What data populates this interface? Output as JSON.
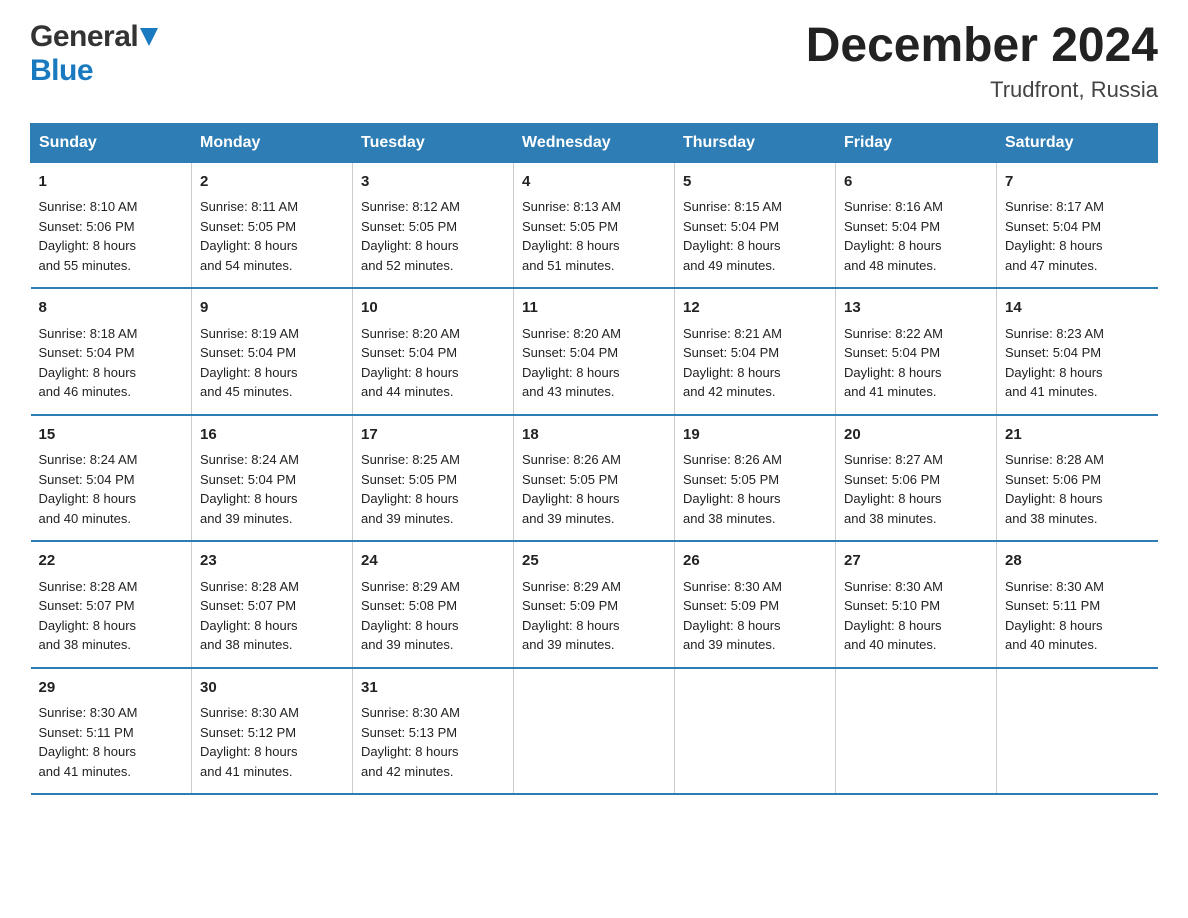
{
  "header": {
    "logo_general": "General",
    "logo_blue": "Blue",
    "title": "December 2024",
    "subtitle": "Trudfront, Russia"
  },
  "columns": [
    "Sunday",
    "Monday",
    "Tuesday",
    "Wednesday",
    "Thursday",
    "Friday",
    "Saturday"
  ],
  "weeks": [
    [
      {
        "day": "1",
        "sunrise": "8:10 AM",
        "sunset": "5:06 PM",
        "daylight": "8 hours and 55 minutes."
      },
      {
        "day": "2",
        "sunrise": "8:11 AM",
        "sunset": "5:05 PM",
        "daylight": "8 hours and 54 minutes."
      },
      {
        "day": "3",
        "sunrise": "8:12 AM",
        "sunset": "5:05 PM",
        "daylight": "8 hours and 52 minutes."
      },
      {
        "day": "4",
        "sunrise": "8:13 AM",
        "sunset": "5:05 PM",
        "daylight": "8 hours and 51 minutes."
      },
      {
        "day": "5",
        "sunrise": "8:15 AM",
        "sunset": "5:04 PM",
        "daylight": "8 hours and 49 minutes."
      },
      {
        "day": "6",
        "sunrise": "8:16 AM",
        "sunset": "5:04 PM",
        "daylight": "8 hours and 48 minutes."
      },
      {
        "day": "7",
        "sunrise": "8:17 AM",
        "sunset": "5:04 PM",
        "daylight": "8 hours and 47 minutes."
      }
    ],
    [
      {
        "day": "8",
        "sunrise": "8:18 AM",
        "sunset": "5:04 PM",
        "daylight": "8 hours and 46 minutes."
      },
      {
        "day": "9",
        "sunrise": "8:19 AM",
        "sunset": "5:04 PM",
        "daylight": "8 hours and 45 minutes."
      },
      {
        "day": "10",
        "sunrise": "8:20 AM",
        "sunset": "5:04 PM",
        "daylight": "8 hours and 44 minutes."
      },
      {
        "day": "11",
        "sunrise": "8:20 AM",
        "sunset": "5:04 PM",
        "daylight": "8 hours and 43 minutes."
      },
      {
        "day": "12",
        "sunrise": "8:21 AM",
        "sunset": "5:04 PM",
        "daylight": "8 hours and 42 minutes."
      },
      {
        "day": "13",
        "sunrise": "8:22 AM",
        "sunset": "5:04 PM",
        "daylight": "8 hours and 41 minutes."
      },
      {
        "day": "14",
        "sunrise": "8:23 AM",
        "sunset": "5:04 PM",
        "daylight": "8 hours and 41 minutes."
      }
    ],
    [
      {
        "day": "15",
        "sunrise": "8:24 AM",
        "sunset": "5:04 PM",
        "daylight": "8 hours and 40 minutes."
      },
      {
        "day": "16",
        "sunrise": "8:24 AM",
        "sunset": "5:04 PM",
        "daylight": "8 hours and 39 minutes."
      },
      {
        "day": "17",
        "sunrise": "8:25 AM",
        "sunset": "5:05 PM",
        "daylight": "8 hours and 39 minutes."
      },
      {
        "day": "18",
        "sunrise": "8:26 AM",
        "sunset": "5:05 PM",
        "daylight": "8 hours and 39 minutes."
      },
      {
        "day": "19",
        "sunrise": "8:26 AM",
        "sunset": "5:05 PM",
        "daylight": "8 hours and 38 minutes."
      },
      {
        "day": "20",
        "sunrise": "8:27 AM",
        "sunset": "5:06 PM",
        "daylight": "8 hours and 38 minutes."
      },
      {
        "day": "21",
        "sunrise": "8:28 AM",
        "sunset": "5:06 PM",
        "daylight": "8 hours and 38 minutes."
      }
    ],
    [
      {
        "day": "22",
        "sunrise": "8:28 AM",
        "sunset": "5:07 PM",
        "daylight": "8 hours and 38 minutes."
      },
      {
        "day": "23",
        "sunrise": "8:28 AM",
        "sunset": "5:07 PM",
        "daylight": "8 hours and 38 minutes."
      },
      {
        "day": "24",
        "sunrise": "8:29 AM",
        "sunset": "5:08 PM",
        "daylight": "8 hours and 39 minutes."
      },
      {
        "day": "25",
        "sunrise": "8:29 AM",
        "sunset": "5:09 PM",
        "daylight": "8 hours and 39 minutes."
      },
      {
        "day": "26",
        "sunrise": "8:30 AM",
        "sunset": "5:09 PM",
        "daylight": "8 hours and 39 minutes."
      },
      {
        "day": "27",
        "sunrise": "8:30 AM",
        "sunset": "5:10 PM",
        "daylight": "8 hours and 40 minutes."
      },
      {
        "day": "28",
        "sunrise": "8:30 AM",
        "sunset": "5:11 PM",
        "daylight": "8 hours and 40 minutes."
      }
    ],
    [
      {
        "day": "29",
        "sunrise": "8:30 AM",
        "sunset": "5:11 PM",
        "daylight": "8 hours and 41 minutes."
      },
      {
        "day": "30",
        "sunrise": "8:30 AM",
        "sunset": "5:12 PM",
        "daylight": "8 hours and 41 minutes."
      },
      {
        "day": "31",
        "sunrise": "8:30 AM",
        "sunset": "5:13 PM",
        "daylight": "8 hours and 42 minutes."
      },
      {
        "day": "",
        "sunrise": "",
        "sunset": "",
        "daylight": ""
      },
      {
        "day": "",
        "sunrise": "",
        "sunset": "",
        "daylight": ""
      },
      {
        "day": "",
        "sunrise": "",
        "sunset": "",
        "daylight": ""
      },
      {
        "day": "",
        "sunrise": "",
        "sunset": "",
        "daylight": ""
      }
    ]
  ],
  "labels": {
    "sunrise": "Sunrise:",
    "sunset": "Sunset:",
    "daylight": "Daylight:"
  }
}
